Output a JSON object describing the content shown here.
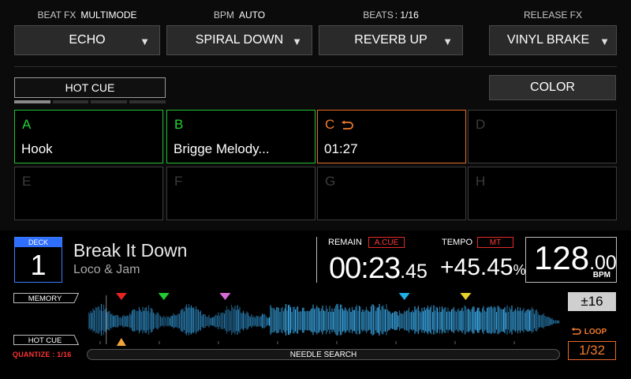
{
  "fx": [
    {
      "label": "BEAT FX",
      "mode": "MULTIMODE",
      "value": "ECHO"
    },
    {
      "label": "BPM",
      "mode": "AUTO",
      "value": "SPIRAL DOWN"
    },
    {
      "label": "BEATS",
      "mode": ": 1/16",
      "value": "REVERB UP"
    },
    {
      "label": "RELEASE FX",
      "mode": "",
      "value": "VINYL BRAKE"
    }
  ],
  "hotcue_tab": "HOT CUE",
  "color_button": "COLOR",
  "pads": [
    {
      "letter": "A",
      "name": "Hook",
      "color": "#22d233"
    },
    {
      "letter": "B",
      "name": "Brigge Melody...",
      "color": "#22d233"
    },
    {
      "letter": "C",
      "name": "01:27",
      "color": "#f07a2e",
      "loop": true
    },
    {
      "letter": "D",
      "name": ""
    },
    {
      "letter": "E",
      "name": ""
    },
    {
      "letter": "F",
      "name": ""
    },
    {
      "letter": "G",
      "name": ""
    },
    {
      "letter": "H",
      "name": ""
    }
  ],
  "deck": {
    "label": "DECK",
    "number": "1"
  },
  "track": {
    "title": "Break It Down",
    "artist": "Loco & Jam"
  },
  "remain": {
    "label": "REMAIN",
    "badge": "A.CUE",
    "main": "00:23",
    "frac": ".45"
  },
  "tempo": {
    "label": "TEMPO",
    "badge": "MT",
    "main": "+45.45",
    "unit": "%"
  },
  "bpm": {
    "main": "128",
    "frac": ".00",
    "unit": "BPM"
  },
  "memory_label": "MEMORY",
  "hotcue_label": "HOT CUE",
  "quantize": "QUANTIZE : 1/16",
  "needle_search": "NEEDLE SEARCH",
  "tempo_range": "±16",
  "loop": {
    "label": "LOOP",
    "value": "1/32"
  },
  "colors": {
    "accent_blue": "#2f6fff",
    "green": "#22d233",
    "orange": "#f07a2e",
    "red": "#ff3434",
    "waveform": "#2f9bd6"
  },
  "memory_markers": [
    {
      "position": 0.07,
      "color": "#e52424"
    },
    {
      "position": 0.16,
      "color": "#22c933"
    },
    {
      "position": 0.29,
      "color": "#d86ad8"
    },
    {
      "position": 0.67,
      "color": "#1fb0e6"
    },
    {
      "position": 0.8,
      "color": "#e8d12a"
    }
  ],
  "hotcue_markers": [
    {
      "position": 0.07,
      "color": "#f0a43a"
    }
  ],
  "playhead_position": 0.038
}
